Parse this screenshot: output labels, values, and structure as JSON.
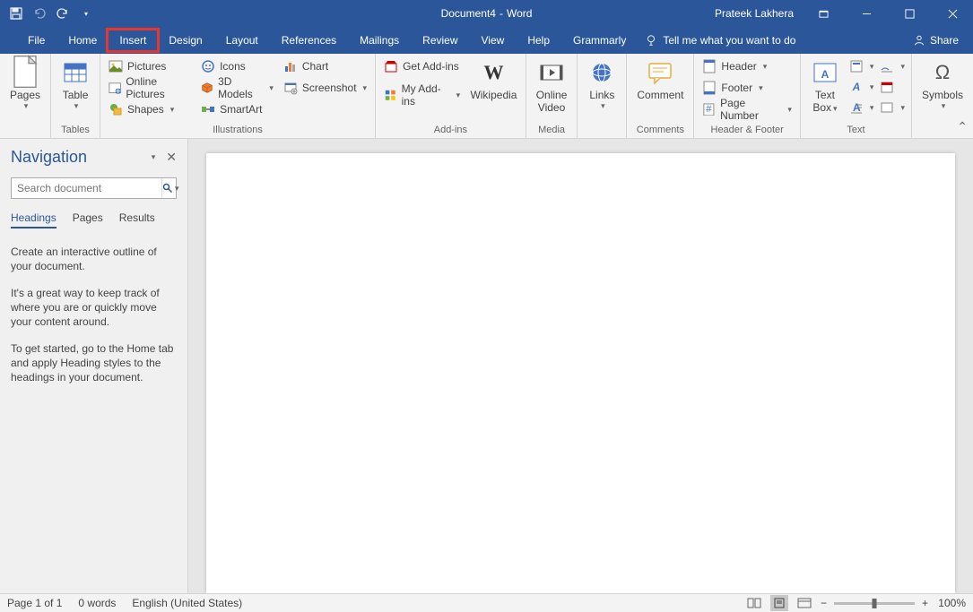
{
  "title": {
    "doc": "Document4",
    "sep": " - ",
    "app": "Word"
  },
  "user": "Prateek Lakhera",
  "menu": {
    "file": "File",
    "home": "Home",
    "insert": "Insert",
    "design": "Design",
    "layout": "Layout",
    "references": "References",
    "mailings": "Mailings",
    "review": "Review",
    "view": "View",
    "help": "Help",
    "grammarly": "Grammarly",
    "tellme": "Tell me what you want to do",
    "share": "Share"
  },
  "ribbon": {
    "pages": {
      "label": "Pages",
      "btn": "Pages"
    },
    "tables": {
      "label": "Tables",
      "btn": "Table"
    },
    "illus": {
      "label": "Illustrations",
      "pictures": "Pictures",
      "online": "Online Pictures",
      "shapes": "Shapes",
      "icons": "Icons",
      "models": "3D Models",
      "smartart": "SmartArt",
      "chart": "Chart",
      "screenshot": "Screenshot"
    },
    "addins": {
      "label": "Add-ins",
      "get": "Get Add-ins",
      "my": "My Add-ins",
      "wiki": "Wikipedia"
    },
    "media": {
      "label": "Media",
      "video1": "Online",
      "video2": "Video"
    },
    "links": {
      "btn": "Links"
    },
    "comments": {
      "label": "Comments",
      "btn": "Comment"
    },
    "hf": {
      "label": "Header & Footer",
      "header": "Header",
      "footer": "Footer",
      "pagenum": "Page Number"
    },
    "text": {
      "label": "Text",
      "box1": "Text",
      "box2": "Box"
    },
    "symbols": {
      "label": "Symbols",
      "btn": "Symbols"
    }
  },
  "nav": {
    "title": "Navigation",
    "search_ph": "Search document",
    "tabs": {
      "headings": "Headings",
      "pages": "Pages",
      "results": "Results"
    },
    "help": {
      "p1": "Create an interactive outline of your document.",
      "p2": "It's a great way to keep track of where you are or quickly move your content around.",
      "p3": "To get started, go to the Home tab and apply Heading styles to the headings in your document."
    }
  },
  "status": {
    "page": "Page 1 of 1",
    "words": "0 words",
    "lang": "English (United States)",
    "zoom": "100%"
  }
}
